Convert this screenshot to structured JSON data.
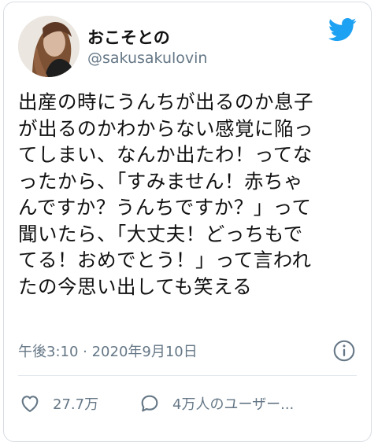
{
  "user": {
    "display_name": "おこそとの",
    "handle": "@sakusakulovin"
  },
  "tweet": {
    "lines": [
      "出産の時にうんちが出るのか息子",
      "が出るのかわからない感覚に陥っ",
      "てしまい、なんか出たわ！ってな",
      "ったから、「すみません！赤ちゃ",
      "んですか？うんちですか？」って",
      "聞いたら、「大丈夫！どっちもで",
      "てる！おめでとう！」って言われ",
      "たの今思い出しても笑える"
    ],
    "timestamp": "午後3:10 · 2020年9月10日"
  },
  "actions": {
    "likes": "27.7万",
    "reply_text": "4万人のユーザー..."
  },
  "colors": {
    "twitter_blue": "#1DA1F2",
    "secondary_text": "#657786"
  },
  "icons": [
    "avatar",
    "twitter-bird-icon",
    "info-icon",
    "heart-icon",
    "speech-bubble-icon"
  ]
}
